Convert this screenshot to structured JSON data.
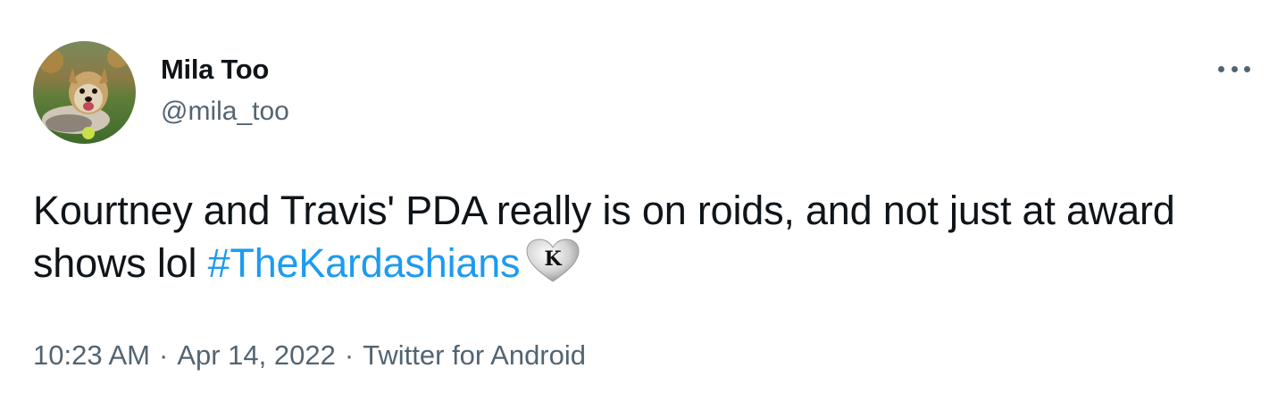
{
  "user": {
    "display_name": "Mila Too",
    "handle": "@mila_too",
    "avatar_icon": "yorkshire-terrier-avatar"
  },
  "more_menu": {
    "icon": "more-horizontal-icon"
  },
  "tweet": {
    "text": "Kourtney and Travis' PDA really is on roids, and not just at award shows lol ",
    "hashtag": "#TheKardashians",
    "hashtag_emoji_letter": "K",
    "hashtag_emoji_icon": "kardashians-heart-icon"
  },
  "meta": {
    "time": "10:23 AM",
    "separator": "·",
    "date": "Apr 14, 2022",
    "source": "Twitter for Android"
  },
  "colors": {
    "text_primary": "#0f1419",
    "text_secondary": "#536471",
    "link": "#1d9bf0"
  }
}
